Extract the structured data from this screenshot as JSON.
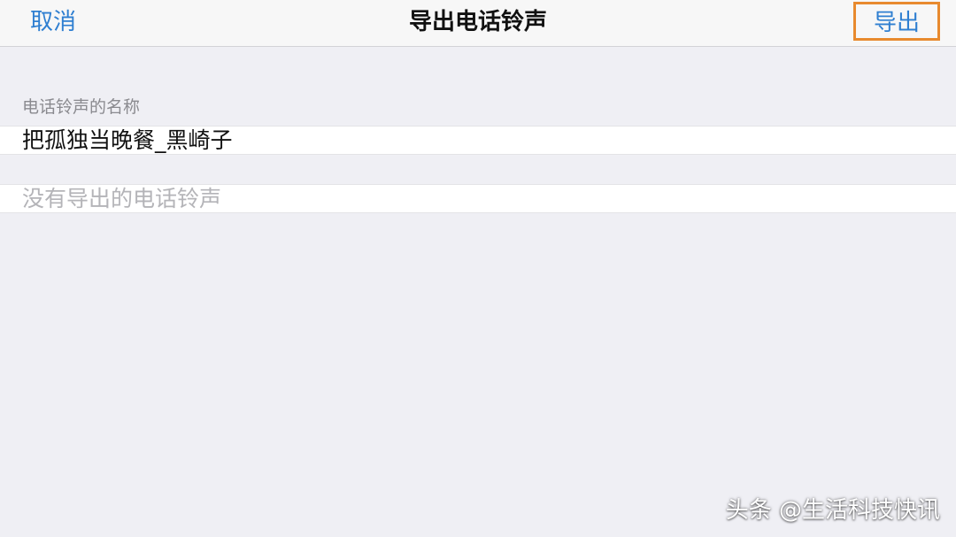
{
  "navbar": {
    "cancel_label": "取消",
    "title": "导出电话铃声",
    "export_label": "导出"
  },
  "form": {
    "name_section_label": "电话铃声的名称",
    "name_value": "把孤独当晚餐_黑崎子",
    "empty_message": "没有导出的电话铃声"
  },
  "watermark": {
    "text": "头条 @生活科技快讯"
  },
  "colors": {
    "accent": "#2f7fd1",
    "highlight_border": "#e88a2e",
    "background": "#efeff4"
  }
}
